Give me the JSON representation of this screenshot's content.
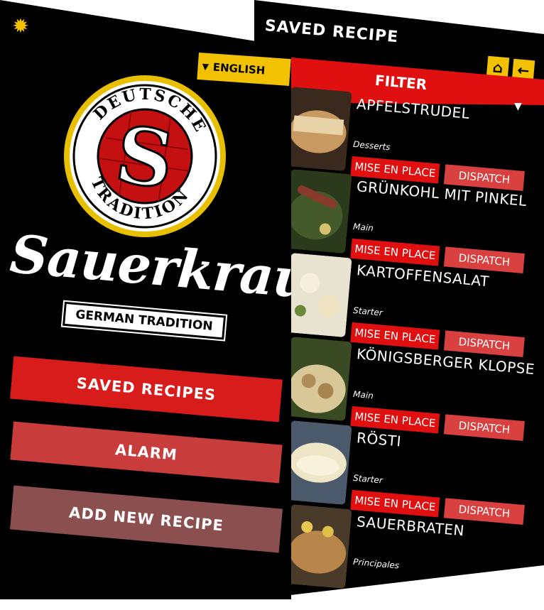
{
  "left": {
    "language": "ENGLISH",
    "brand": {
      "seal_top": "DEUTSCHE",
      "seal_bottom": "TRADITION",
      "seal_letter": "S",
      "title": "Sauerkraut",
      "subtitle": "GERMAN TRADITION"
    },
    "menu": [
      {
        "label": "SAVED RECIPES"
      },
      {
        "label": "ALARM"
      },
      {
        "label": "ADD NEW RECIPE"
      }
    ]
  },
  "right": {
    "title": "SAVED RECIPE",
    "filter_label": "FILTER",
    "nav": {
      "home_icon": "home-icon",
      "back_icon": "back-arrow-icon"
    },
    "recipes": [
      {
        "name": "APFELSTRUDEL",
        "category": "Desserts",
        "mise": "MISE EN PLACE",
        "dispatch": "DISPATCH"
      },
      {
        "name": "GRÜNKOHL MIT PINKEL",
        "category": "Main",
        "mise": "MISE EN PLACE",
        "dispatch": "DISPATCH"
      },
      {
        "name": "KARTOFFENSALAT",
        "category": "Starter",
        "mise": "MISE EN PLACE",
        "dispatch": "DISPATCH"
      },
      {
        "name": "KÖNIGSBERGER KLOPSE",
        "category": "Main",
        "mise": "MISE EN PLACE",
        "dispatch": "DISPATCH"
      },
      {
        "name": "RÖSTI",
        "category": "Starter",
        "mise": "MISE EN PLACE",
        "dispatch": "DISPATCH"
      },
      {
        "name": "SAUERBRATEN",
        "category": "Principales",
        "mise": "",
        "dispatch": ""
      }
    ]
  },
  "colors": {
    "accent_red": "#e01010",
    "accent_yellow": "#f2c200",
    "background": "#000000"
  }
}
